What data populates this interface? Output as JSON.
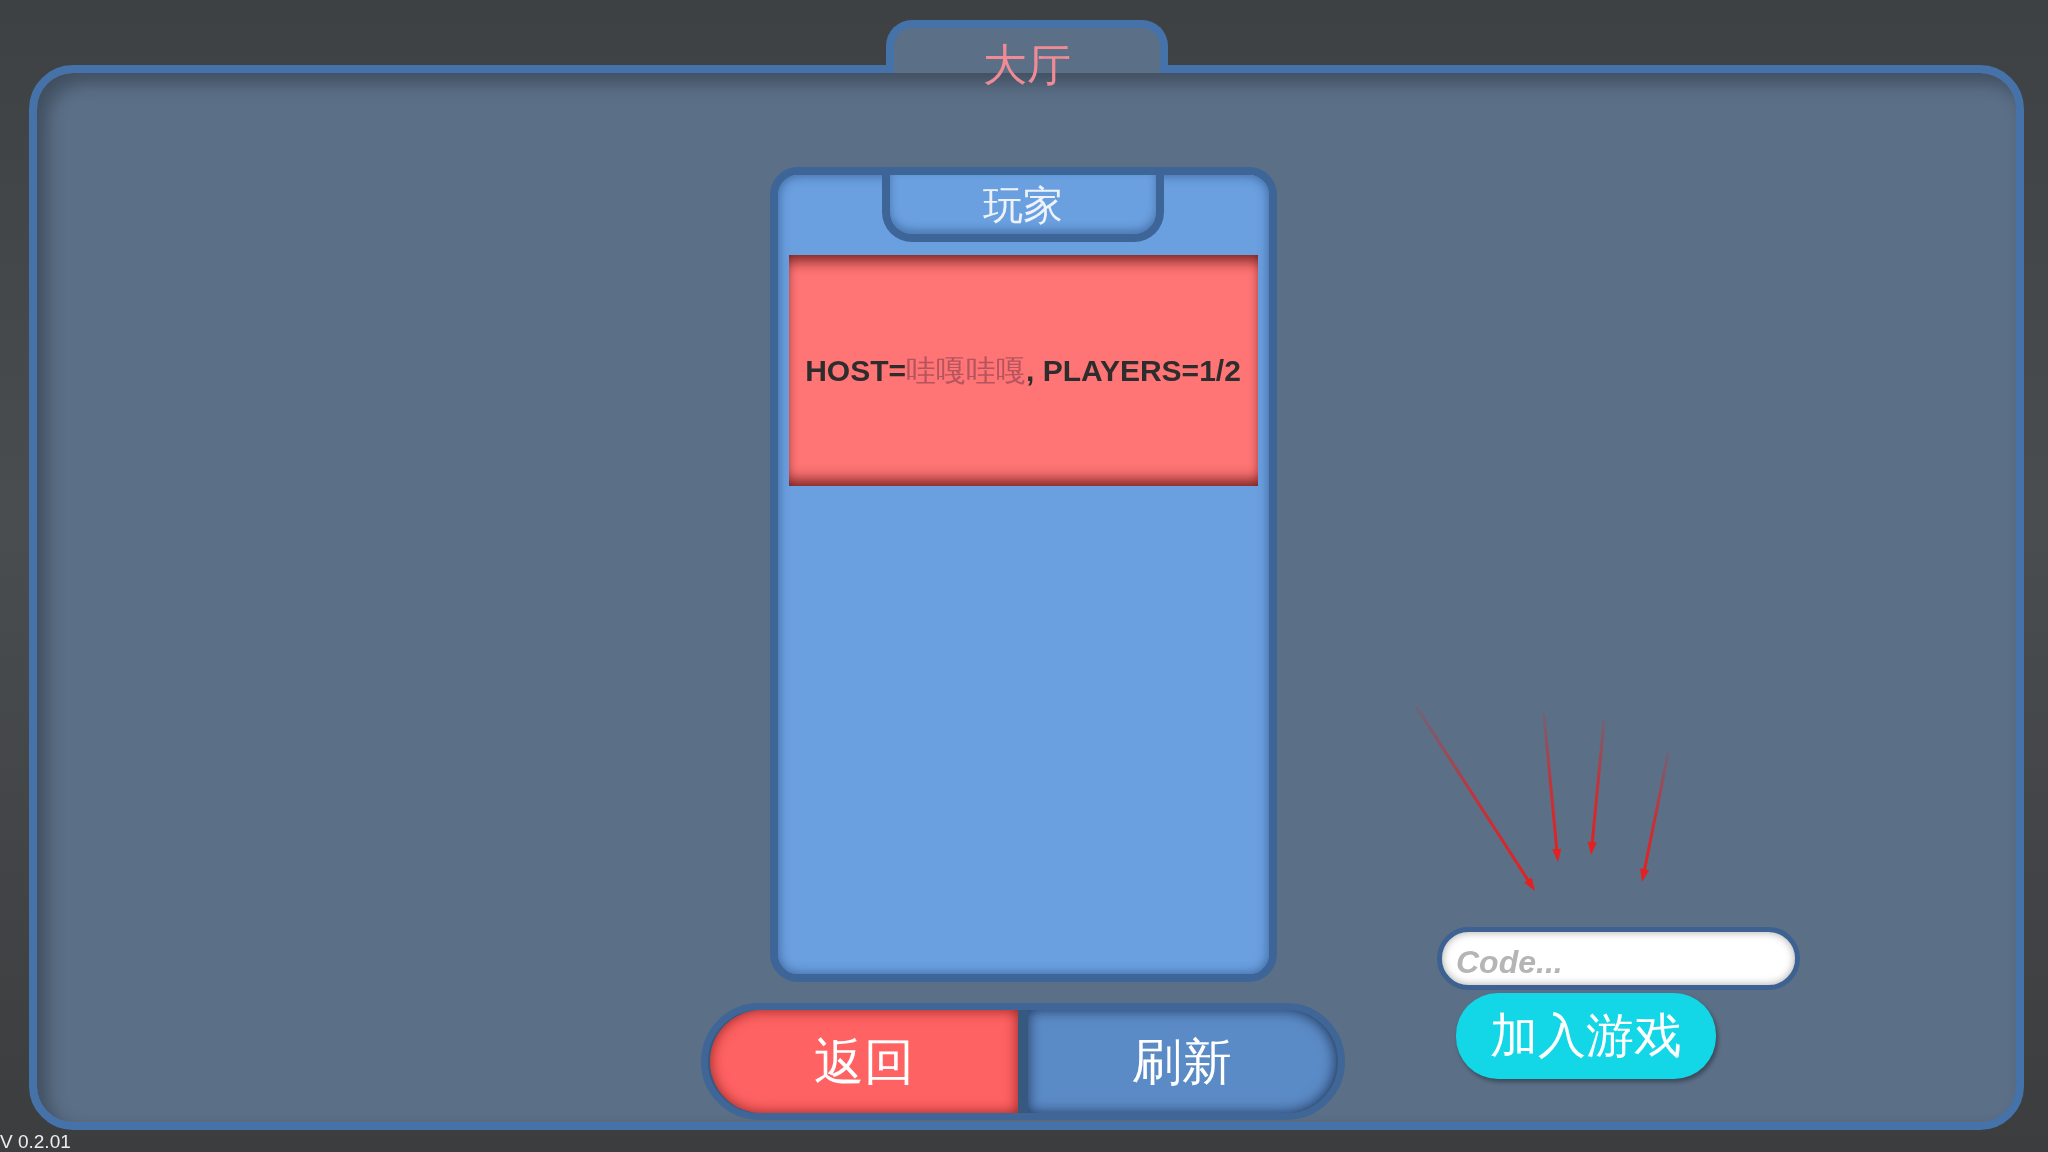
{
  "lobby": {
    "title": "大厅"
  },
  "player_list": {
    "title": "玩家",
    "rooms": [
      {
        "text": "**HOST=**哇嘎哇嘎**, PLAYERS=1/2**"
      }
    ]
  },
  "buttons": [
    {
      "kind": "back",
      "label": "返回"
    },
    {
      "kind": "refresh",
      "label": "刷新"
    }
  ],
  "join": {
    "code_field": {
      "placeholder": "Code..."
    },
    "button": {
      "label": "加入游戏"
    }
  },
  "version": "V 0.2.01"
}
